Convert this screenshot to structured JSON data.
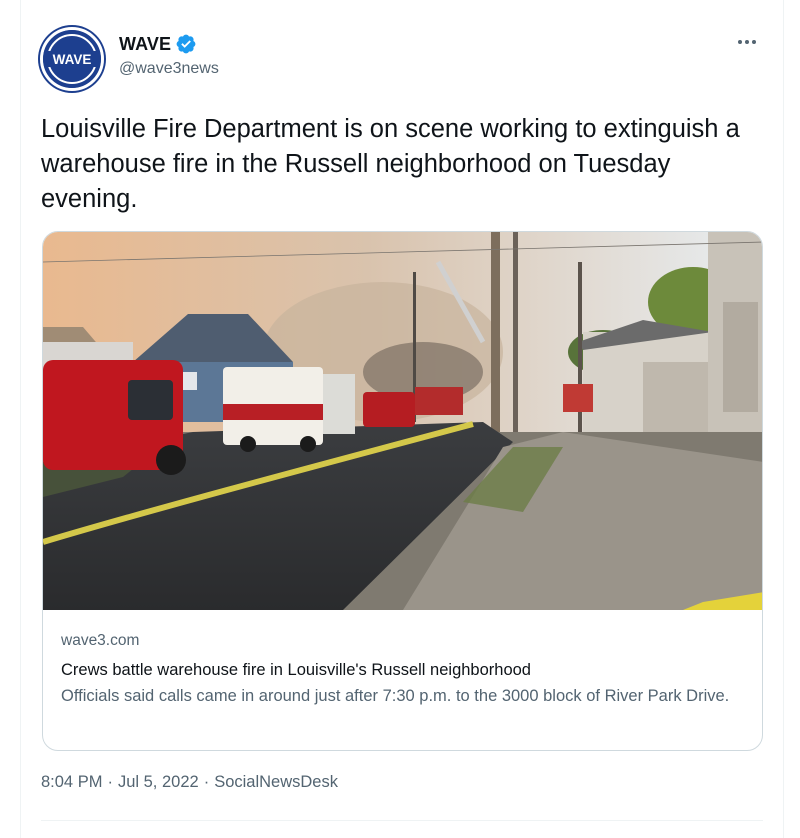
{
  "author": {
    "name": "WAVE",
    "handle": "@wave3news",
    "avatar_text": "WAVE",
    "verified": true,
    "verified_color": "#1d9bf0",
    "avatar_color": "#1d3f8f"
  },
  "tweet": {
    "text": "Louisville Fire Department is on scene working to extinguish a warehouse fire in the Russell neighborhood on Tuesday evening."
  },
  "card": {
    "domain": "wave3.com",
    "title": "Crews battle warehouse fire in Louisville's Russell neighborhood",
    "description": "Officials said calls came in around just after 7:30 p.m. to the 3000 block of River Park Drive.",
    "image_icon": "news-photo"
  },
  "meta": {
    "time": "8:04 PM",
    "separator": "·",
    "date": "Jul 5, 2022",
    "source": "SocialNewsDesk"
  },
  "icons": {
    "more": "more-options-icon",
    "verified": "verified-badge-icon"
  }
}
